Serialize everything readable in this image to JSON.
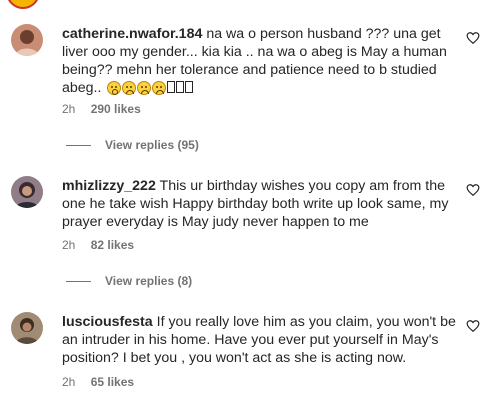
{
  "comments": [
    {
      "username": "catherine.nwafor.184",
      "text": "na wa o person husband ??? una get liver ooo my gender... kia kia .. na wa o abeg is May a human being?? mehn her tolerance and patience need to b studied abeg..",
      "emojis": [
        "astonished-face",
        "frowning-face",
        "frowning-face",
        "frowning-face"
      ],
      "time": "2h",
      "likes": "290 likes",
      "view_replies": "View replies (95)",
      "avatar_color": "#d8a28a"
    },
    {
      "username": "mhizlizzy_222",
      "text": "This ur birthday wishes you copy am from the one he take wish Happy birthday both write up look same, my prayer everyday is May judy never happen to me",
      "time": "2h",
      "likes": "82 likes",
      "view_replies": "View replies (8)",
      "avatar_color": "#5b4a55"
    },
    {
      "username": "lusciousfesta",
      "text": "If you really love him as you claim, you won't be an intruder in his home. Have you ever put yourself in May's position? I bet you , you won't act as she is acting now.",
      "time": "2h",
      "likes": "65 likes",
      "avatar_color": "#7a6a5a"
    }
  ]
}
